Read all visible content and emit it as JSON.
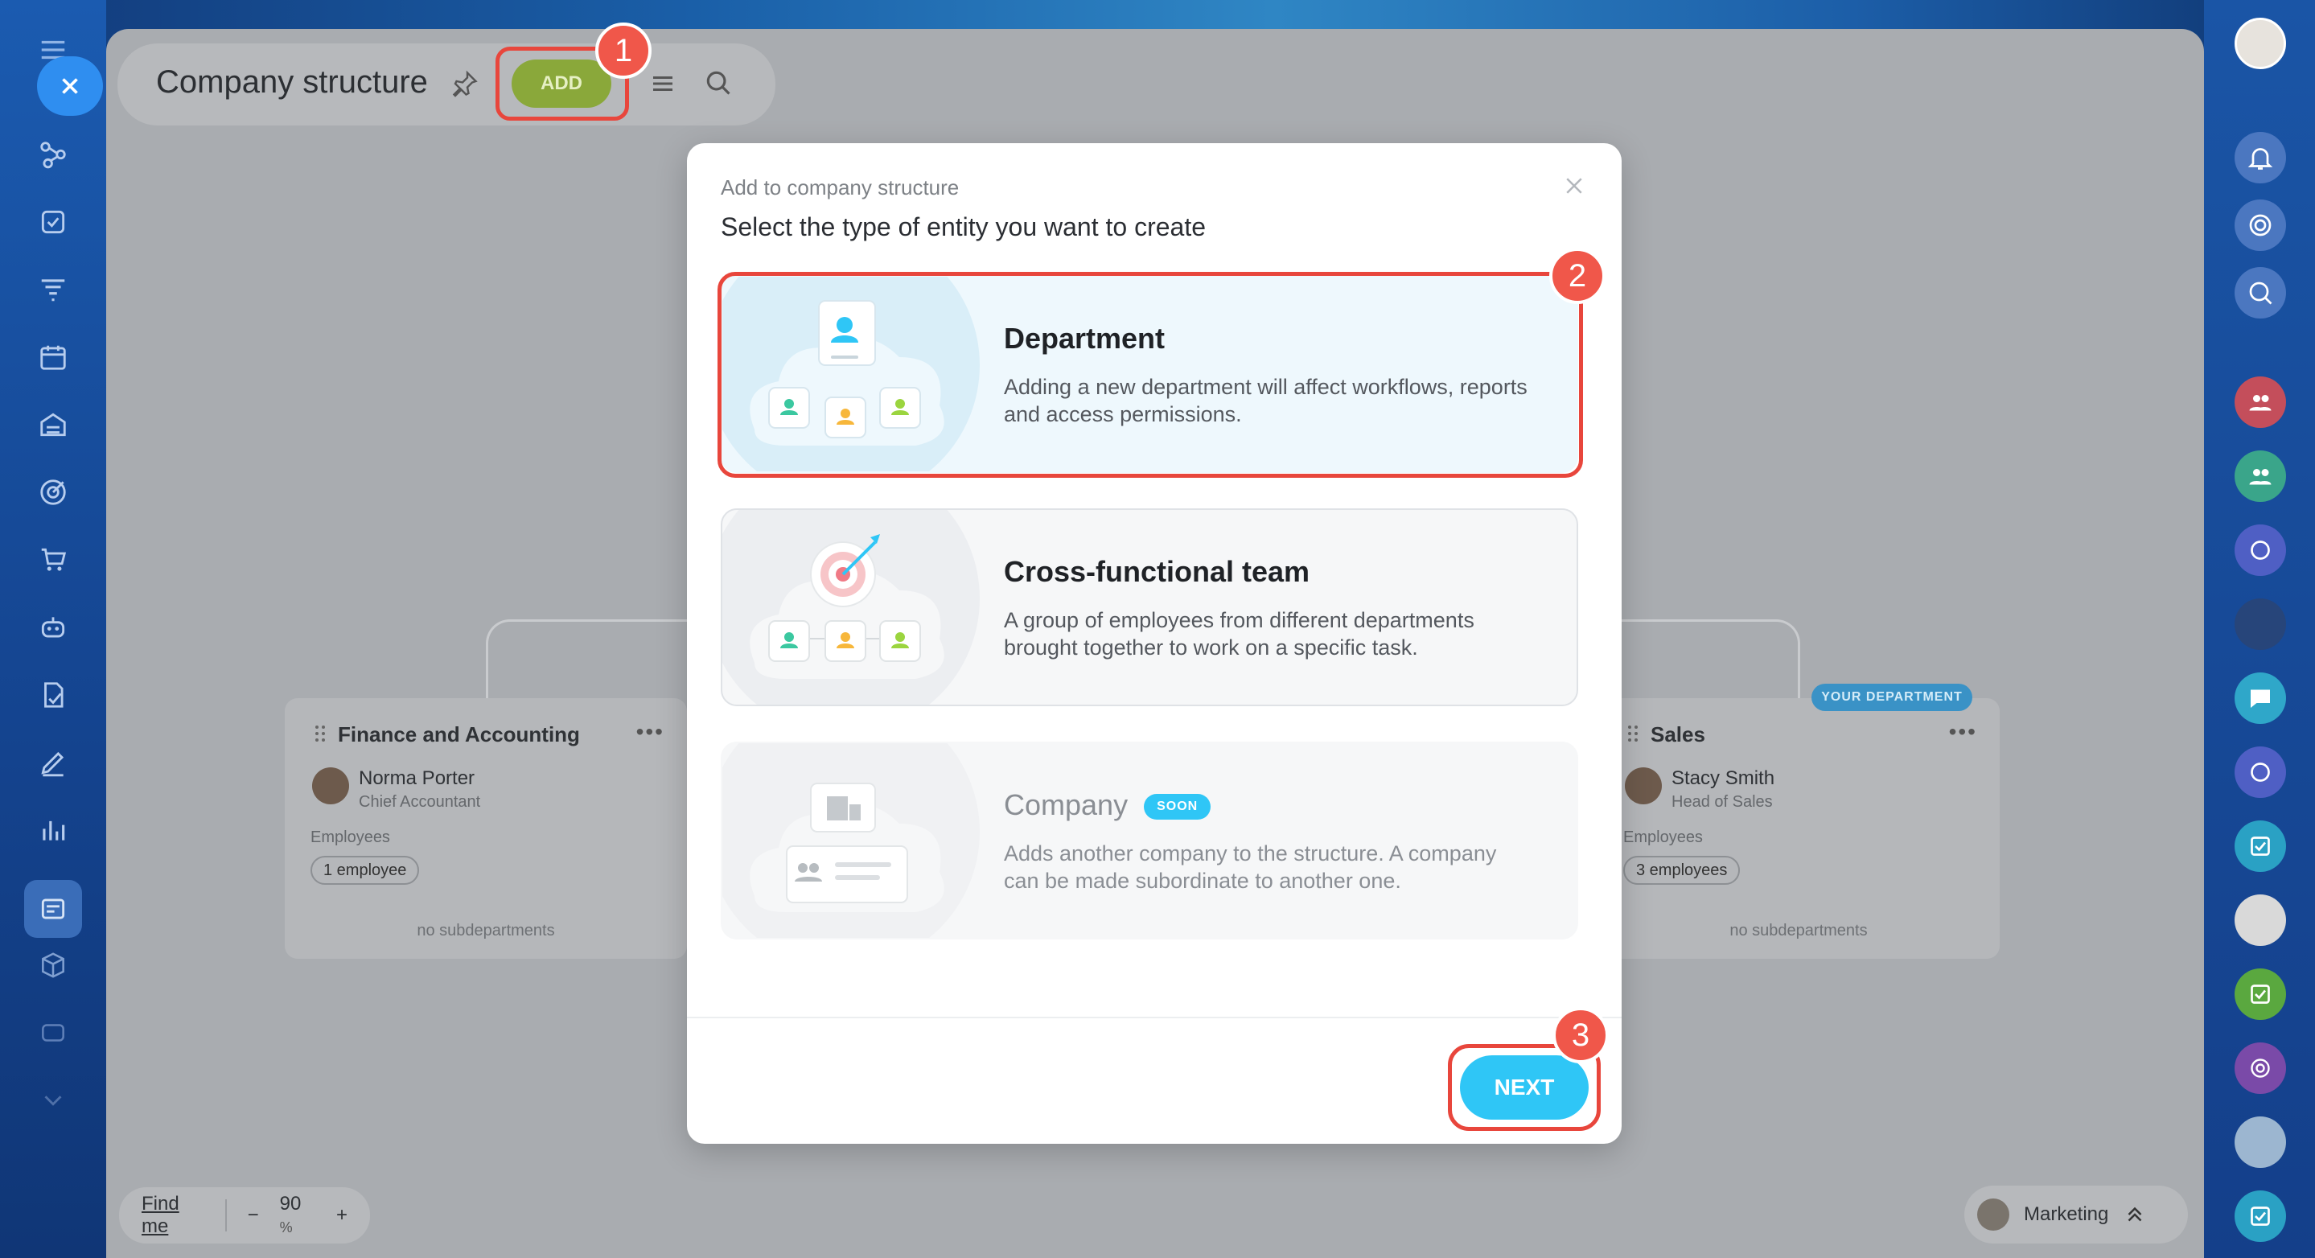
{
  "header": {
    "title": "Company structure",
    "add_label": "ADD"
  },
  "annotations": [
    "1",
    "2",
    "3"
  ],
  "dialog": {
    "subtitle": "Add to company structure",
    "heading": "Select the type of entity you want to create",
    "options": [
      {
        "title": "Department",
        "description": "Adding a new department will affect workflows, reports and access permissions."
      },
      {
        "title": "Cross-functional team",
        "description": "A group of employees from different departments brought together to work on a specific task."
      },
      {
        "title": "Company",
        "badge": "SOON",
        "description": "Adds another company to the structure. A company can be made subordinate to another one."
      }
    ],
    "next_label": "NEXT"
  },
  "org": {
    "cards": [
      {
        "name": "Finance and Accounting",
        "person": "Norma Porter",
        "role": "Chief Accountant",
        "employees_label": "Employees",
        "employees": "1 employee",
        "subdepartments": "no subdepartments"
      },
      {
        "name": "Sales",
        "person": "Stacy Smith",
        "role": "Head of Sales",
        "employees_label": "Employees",
        "employees": "3 employees",
        "subdepartments": "no subdepartments",
        "tag": "YOUR DEPARTMENT"
      }
    ]
  },
  "bottom": {
    "find_me": "Find me",
    "zoom_minus": "−",
    "zoom_value": "90",
    "zoom_unit": "%",
    "zoom_plus": "+",
    "dept_name": "Marketing"
  },
  "colors": {
    "accent": "#2fc6f6",
    "add_button": "#8aa83a",
    "highlight": "#e8463c"
  }
}
